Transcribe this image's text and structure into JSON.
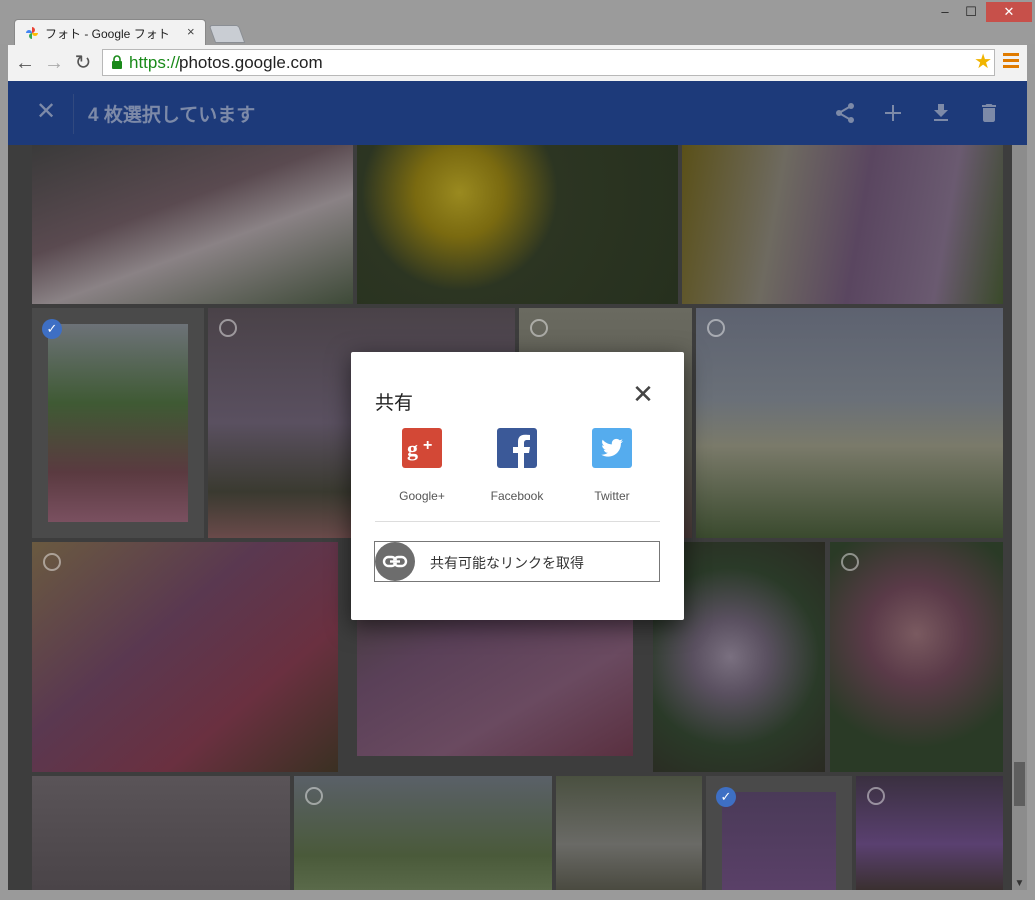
{
  "browser": {
    "tab_title": "フォト - Google フォト",
    "tab_close": "×",
    "url_scheme": "https://",
    "url_host": "photos.google.com",
    "win_min": "‒",
    "win_max": "☐",
    "win_close": "✕",
    "back": "←",
    "forward": "→",
    "reload": "↻",
    "star": "★"
  },
  "app_header": {
    "close_glyph": "✕",
    "selection_count": "4 枚選択しています",
    "color": "#1d3a7a"
  },
  "share_dialog": {
    "title": "共有",
    "close_glyph": "✕",
    "options": [
      {
        "label": "Google+",
        "icon": "google-plus-icon",
        "color": "#d34836"
      },
      {
        "label": "Facebook",
        "icon": "facebook-icon",
        "color": "#3b5998"
      },
      {
        "label": "Twitter",
        "icon": "twitter-icon",
        "color": "#55acee"
      }
    ],
    "link_label": "共有可能なリンクを取得"
  },
  "photos": [
    {
      "id": "r1c1",
      "selected": false
    },
    {
      "id": "r1c2",
      "selected": false
    },
    {
      "id": "r1c3",
      "selected": false
    },
    {
      "id": "r2c1",
      "selected": true
    },
    {
      "id": "r2c2",
      "selected": false
    },
    {
      "id": "r2c3",
      "selected": false
    },
    {
      "id": "r2c4",
      "selected": false
    },
    {
      "id": "r3c1",
      "selected": false
    },
    {
      "id": "r3c2",
      "selected": false
    },
    {
      "id": "r3c3",
      "selected": false
    },
    {
      "id": "r3c4",
      "selected": false
    },
    {
      "id": "r4c1",
      "selected": false
    },
    {
      "id": "r4c2",
      "selected": false
    },
    {
      "id": "r4c3",
      "selected": false
    },
    {
      "id": "r4c4",
      "selected": true
    },
    {
      "id": "r4c5",
      "selected": false
    }
  ]
}
